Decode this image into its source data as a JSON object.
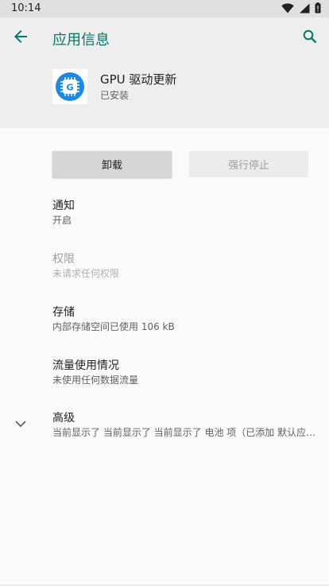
{
  "status_bar": {
    "time": "10:14",
    "icons": [
      "wifi-icon",
      "signal-icon",
      "battery-icon"
    ]
  },
  "app_bar": {
    "title": "应用信息",
    "back_icon": "arrow-back-icon",
    "search_icon": "search-icon"
  },
  "app": {
    "name": "GPU 驱动更新",
    "status": "已安装",
    "icon_letter": "G"
  },
  "buttons": {
    "uninstall": "卸载",
    "force_stop": "强行停止"
  },
  "rows": [
    {
      "title": "通知",
      "summary": "开启",
      "enabled": true
    },
    {
      "title": "权限",
      "summary": "未请求任何权限",
      "enabled": false
    },
    {
      "title": "存储",
      "summary": "内部存储空间已使用 106 kB",
      "enabled": true
    },
    {
      "title": "流量使用情况",
      "summary": "未使用任何数据流量",
      "enabled": true
    },
    {
      "title": "高级",
      "summary": "当前显示了 当前显示了 当前显示了 电池 项（已添加 默认应用、在其他应用上层显示）",
      "enabled": true
    }
  ],
  "colors": {
    "accent": "#00796b",
    "status_bar_bg": "#e0e0e0",
    "header_bg": "#eeeeee",
    "page_bg": "#fafafa"
  }
}
